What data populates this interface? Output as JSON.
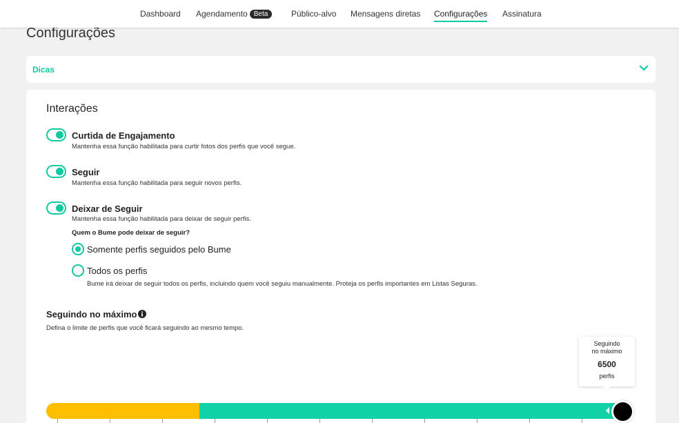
{
  "nav": {
    "items": [
      {
        "label": "Dashboard"
      },
      {
        "label": "Agendamento",
        "badge": "Beta"
      },
      {
        "label": "Público-alvo"
      },
      {
        "label": "Mensagens diretas"
      },
      {
        "label": "Configurações",
        "active": true
      },
      {
        "label": "Assinatura"
      }
    ]
  },
  "page": {
    "title": "Configurações"
  },
  "dicas": {
    "label": "Dicas",
    "icon": "chevron-down-icon"
  },
  "interactions": {
    "title": "Interações",
    "options": [
      {
        "title": "Curtida de Engajamento",
        "description": "Mantenha essa função habilitada para curtir fotos dos perfis que você segue.",
        "enabled": true
      },
      {
        "title": "Seguir",
        "description": "Mantenha essa função habilitada para seguir novos perfis.",
        "enabled": true
      },
      {
        "title": "Deixar de Seguir",
        "description": "Mantenha essa função habilitada para deixar de seguir perfis.",
        "enabled": true
      }
    ],
    "unfollow_question": "Quem o Bume pode deixar de seguir?",
    "radios": [
      {
        "label": "Somente perfis seguidos pelo Bume",
        "selected": true
      },
      {
        "label": "Todos os perfis",
        "selected": false
      }
    ],
    "all_profiles_note": "Bume irá deixar de seguir todos os perfis, incluindo quem você seguiu manualmente. Proteja os perfis importantes em Listas Seguras."
  },
  "max_following": {
    "title": "Seguindo no máximo",
    "info_icon": "info-icon",
    "description": "Defina o limite de perfis que você ficará seguindo ao mesmo tempo.",
    "tooltip": {
      "line1": "Seguindo",
      "line2": "no máximo",
      "value": "6500",
      "unit": "perfis"
    },
    "value": 6500,
    "max": 6500,
    "fill_fraction": 1.0,
    "warning_fraction": 0.266
  },
  "colors": {
    "accent": "#0fc9a0",
    "warning": "#ffbf00",
    "handle": "#000000"
  }
}
